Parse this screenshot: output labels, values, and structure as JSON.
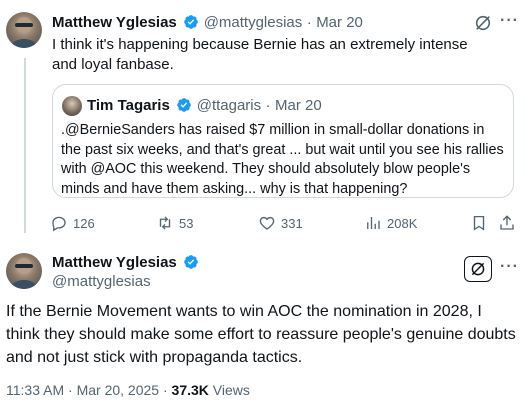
{
  "tweet1": {
    "author_name": "Matthew Yglesias",
    "handle": "@mattyglesias",
    "separator": "·",
    "date": "Mar 20",
    "text": "I think it's happening because Bernie has an extremely intense and loyal fanbase."
  },
  "quote": {
    "author_name": "Tim Tagaris",
    "handle": "@ttagaris",
    "separator": "·",
    "date": "Mar 20",
    "text": ".@BernieSanders has raised $7 million in small-dollar donations in the past six weeks, and that's great ... but wait until you see his rallies with @AOC this weekend. They should absolutely blow people's minds and have them asking... why is that happening?"
  },
  "actions": {
    "replies": "126",
    "reposts": "53",
    "likes": "331",
    "views": "208K"
  },
  "tweet2": {
    "author_name": "Matthew Yglesias",
    "handle": "@mattyglesias",
    "text": "If the Bernie Movement wants to win AOC the nomination in 2028, I think they should make some effort to reassure people's genuine doubts and not just stick with propaganda tactics.",
    "time": "11:33 AM",
    "date": "Mar 20, 2025",
    "views_count": "37.3K",
    "views_label": "Views",
    "separator": "·"
  },
  "icons": {
    "more": "···",
    "verified": "verified-badge-icon",
    "grok": "grok-icon"
  },
  "colors": {
    "verified_blue": "#1d9bf0",
    "muted": "#536471",
    "border": "#cfd9de"
  }
}
